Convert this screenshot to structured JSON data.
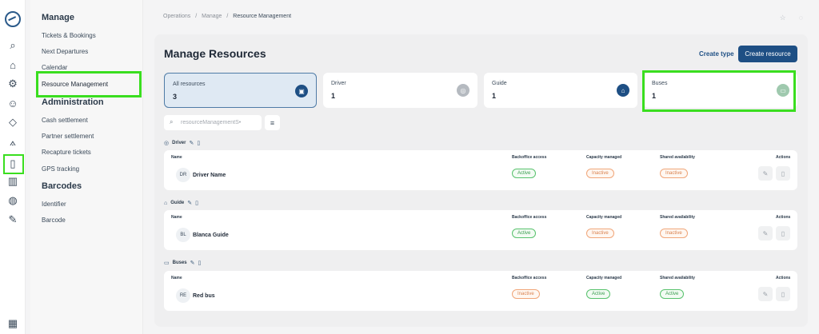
{
  "rail": {
    "icons": [
      "logo-icon",
      "search-icon",
      "home-icon",
      "settings-icon",
      "user-icon",
      "tag-icon",
      "network-icon",
      "clipboard-icon",
      "chart-icon",
      "globe-icon",
      "wrench-icon",
      "building-icon"
    ]
  },
  "submenu": {
    "manage_title": "Manage",
    "manage_items": [
      "Tickets & Bookings",
      "Next Departures",
      "Calendar",
      "Resource Management"
    ],
    "admin_title": "Administration",
    "admin_items": [
      "Cash settlement",
      "Partner settlement",
      "Recapture tickets",
      "GPS tracking"
    ],
    "barcodes_title": "Barcodes",
    "barcodes_items": [
      "Identifier",
      "Barcode"
    ]
  },
  "breadcrumb": {
    "a": "Operations",
    "b": "Manage",
    "c": "Resource Management",
    "sep": "/"
  },
  "page": {
    "title": "Manage Resources",
    "create_type": "Create type",
    "create_resource": "Create resource"
  },
  "cards": [
    {
      "label": "All resources",
      "count": "3",
      "icon": "calendar-icon"
    },
    {
      "label": "Driver",
      "count": "1",
      "icon": "steering-icon"
    },
    {
      "label": "Guide",
      "count": "1",
      "icon": "guide-icon"
    },
    {
      "label": "Buses",
      "count": "1",
      "icon": "bus-icon"
    }
  ],
  "search": {
    "placeholder": "resourceManagementS•"
  },
  "columns": {
    "name": "Name",
    "backoffice": "Backoffice access",
    "capacity": "Capacity managed",
    "shared": "Shared availability",
    "actions": "Actions"
  },
  "groups": [
    {
      "title": "Driver",
      "rows": [
        {
          "initials": "DR",
          "name": "Driver Name",
          "backoffice": "Active",
          "capacity": "Inactive",
          "shared": "Inactive"
        }
      ]
    },
    {
      "title": "Guide",
      "rows": [
        {
          "initials": "BL",
          "name": "Blanca Guide",
          "backoffice": "Active",
          "capacity": "Inactive",
          "shared": "Inactive"
        }
      ]
    },
    {
      "title": "Buses",
      "rows": [
        {
          "initials": "RE",
          "name": "Red bus",
          "backoffice": "Inactive",
          "capacity": "Active",
          "shared": "Active"
        }
      ]
    }
  ],
  "colors": {
    "accent": "#1e4f84",
    "highlight": "#3ade1f",
    "active": "#3a9d50",
    "inactive": "#d9824f"
  }
}
